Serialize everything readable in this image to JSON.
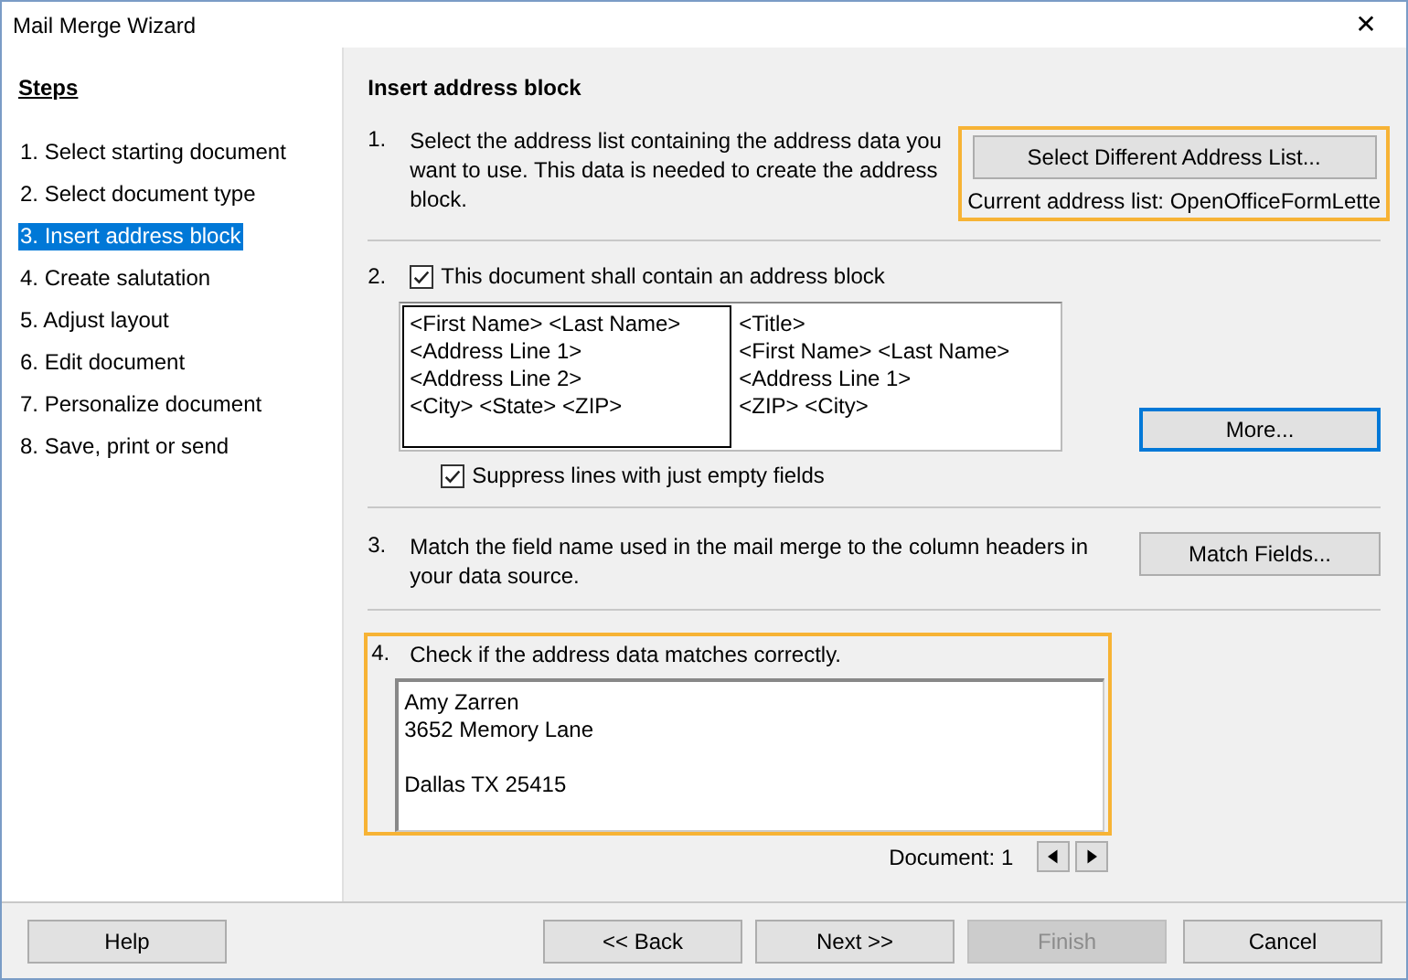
{
  "window": {
    "title": "Mail Merge Wizard",
    "close": "✕"
  },
  "sidebar": {
    "heading": "Steps",
    "items": [
      {
        "label": "1. Select starting document",
        "selected": false
      },
      {
        "label": "2. Select document type",
        "selected": false
      },
      {
        "label": "3. Insert address block",
        "selected": true
      },
      {
        "label": "4. Create salutation",
        "selected": false
      },
      {
        "label": "5. Adjust layout",
        "selected": false
      },
      {
        "label": "6. Edit document",
        "selected": false
      },
      {
        "label": "7. Personalize document",
        "selected": false
      },
      {
        "label": "8. Save, print or send",
        "selected": false
      }
    ]
  },
  "page": {
    "title": "Insert address block",
    "step1": {
      "number": "1.",
      "text": "Select the address list containing the address data you want to use. This data is needed to create the address block.",
      "highlighted": true,
      "button": "Select Different Address List...",
      "current_list": "Current address list: OpenOfficeFormLette"
    },
    "step2": {
      "number": "2.",
      "checkbox": {
        "label": "This document shall contain an address block",
        "checked": true
      },
      "layouts": [
        {
          "lines": [
            "<First Name>  <Last Name>",
            "<Address Line 1>",
            "<Address Line 2>",
            "<City>  <State>  <ZIP>"
          ],
          "selected": true
        },
        {
          "lines": [
            "<Title>",
            "<First Name>  <Last Name>",
            "<Address Line 1>",
            "<ZIP>  <City>"
          ],
          "selected": false
        }
      ],
      "more_button": {
        "label": "More...",
        "focused": true
      },
      "suppress": {
        "label": "Suppress lines with just empty fields",
        "checked": true
      }
    },
    "step3": {
      "number": "3.",
      "text": "Match the field name used in the mail merge to the column headers in your data source.",
      "button": "Match Fields..."
    },
    "step4": {
      "number": "4.",
      "text": "Check if the address data matches correctly.",
      "highlighted": true,
      "preview": [
        [
          "Amy Zarren",
          "3652 Memory Lane"
        ],
        [
          "Dallas TX 25415"
        ]
      ],
      "document_label": "Document: 1"
    }
  },
  "buttons": [
    {
      "label": "Help",
      "disabled": false
    },
    {
      "label": "<< Back",
      "disabled": false
    },
    {
      "label": "Next >>",
      "disabled": false
    },
    {
      "label": "Finish",
      "disabled": true
    },
    {
      "label": "Cancel",
      "disabled": false
    }
  ]
}
